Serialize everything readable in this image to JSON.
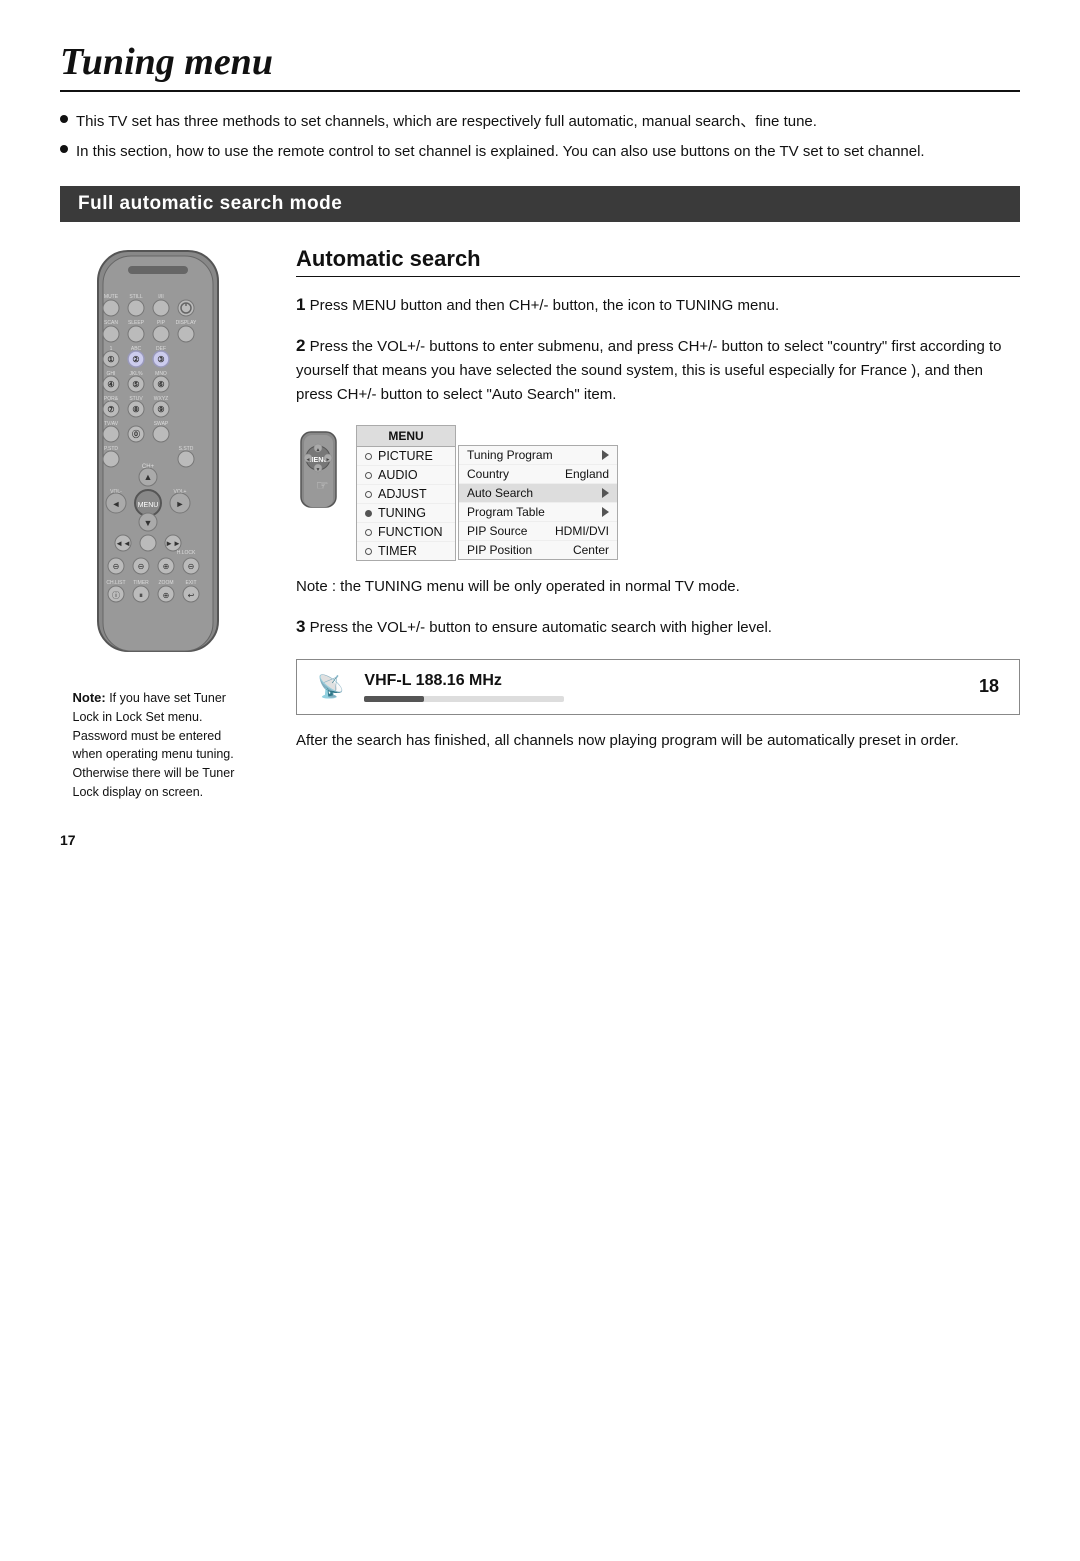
{
  "page": {
    "title": "Tuning menu",
    "page_number": "17"
  },
  "intro": {
    "bullet1": "This TV set has three methods to set channels, which are respectively full automatic, manual search、fine tune.",
    "bullet2": "In this section, how to use the remote control  to set channel is explained. You can also use buttons on the TV set to set channel."
  },
  "section_header": "Full automatic search mode",
  "auto_search": {
    "title": "Automatic search",
    "step1_num": "1",
    "step1_text": "Press MENU  button and then CH+/- button,  the icon to TUNING menu.",
    "step2_num": "2",
    "step2_text": "Press the VOL+/- buttons  to enter submenu, and press CH+/- button to select \"country\" first according to yourself that means you have selected the sound system, this is useful especially for France ), and then press CH+/- button to select \"Auto Search\" item.",
    "note_normal": "Note : the TUNING menu will be only operated  in normal TV mode.",
    "step3_num": "3",
    "step3_text": "Press the VOL+/- button to ensure automatic search with higher level.",
    "tuner_label": "VHF-L  188.16 MHz",
    "tuner_channel": "18",
    "after_text": "After the search has finished, all channels now playing program will be automatically preset in order."
  },
  "menu_diagram": {
    "menu_label": "MENU",
    "items": [
      {
        "label": "PICTURE",
        "dot": "empty"
      },
      {
        "label": "AUDIO",
        "dot": "empty"
      },
      {
        "label": "ADJUST",
        "dot": "empty"
      },
      {
        "label": "TUNING",
        "dot": "filled"
      },
      {
        "label": "FUNCTION",
        "dot": "empty"
      },
      {
        "label": "TIMER",
        "dot": "empty"
      }
    ],
    "submenu_rows": [
      {
        "label": "Tuning Program",
        "value": "⇒"
      },
      {
        "label": "Country",
        "value": "England"
      },
      {
        "label": "Auto Search",
        "value": "⇒"
      },
      {
        "label": "Program Table",
        "value": "⇒"
      },
      {
        "label": "PIP Source",
        "value": "HDMI/DVI"
      },
      {
        "label": "PIP Position",
        "value": "Center"
      }
    ]
  },
  "note": {
    "label": "Note:",
    "text": "If you have set Tuner Lock in Lock Set menu. Password must be entered when operating menu tuning. Otherwise there will be Tuner Lock display on screen."
  }
}
